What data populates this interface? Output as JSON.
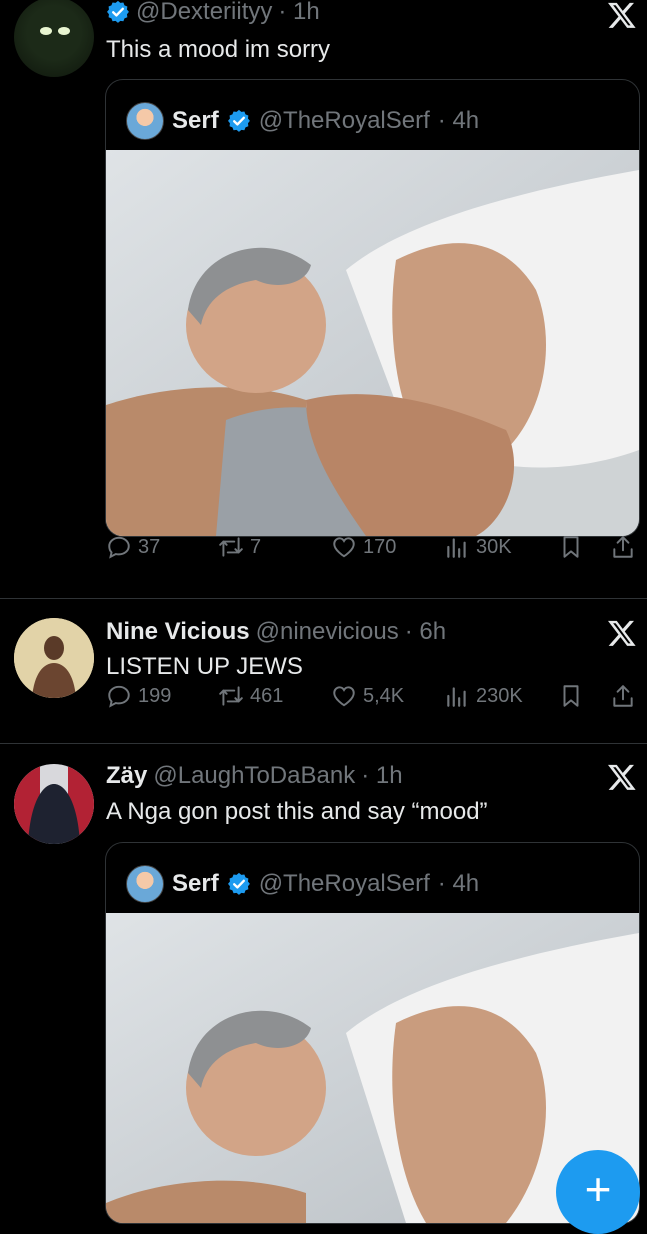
{
  "colors": {
    "background": "#000000",
    "accent": "#1d9bf0",
    "muted": "#71767b",
    "text": "#e7e9ea",
    "separator": "#2f3336"
  },
  "tweets": [
    {
      "handle": "@Dexteriityy",
      "time": "· 1h",
      "text": "This a mood im sorry",
      "verified": true,
      "quote": {
        "name": "Serf",
        "handle": "@TheRoyalSerf",
        "time": "· 4h",
        "verified": true
      },
      "stats": {
        "replies": "37",
        "reposts": "7",
        "likes": "170",
        "views": "30K"
      }
    },
    {
      "name": "Nine Vicious",
      "handle": "@ninevicious",
      "time": "· 6h",
      "text": "LISTEN UP JEWS",
      "stats": {
        "replies": "199",
        "reposts": "461",
        "likes": "5,4K",
        "views": "230K"
      }
    },
    {
      "name": "Zäy",
      "handle": "@LaughToDaBank",
      "time": "· 1h",
      "text": "A Nga gon post this and say “mood”",
      "quote": {
        "name": "Serf",
        "handle": "@TheRoyalSerf",
        "time": "· 4h",
        "verified": true
      }
    }
  ],
  "icons": [
    "verified-badge-icon",
    "x-logo-icon",
    "reply-icon",
    "repost-icon",
    "like-icon",
    "views-icon",
    "bookmark-icon",
    "share-icon",
    "compose-plus-icon"
  ],
  "fab": {
    "label": "+"
  }
}
